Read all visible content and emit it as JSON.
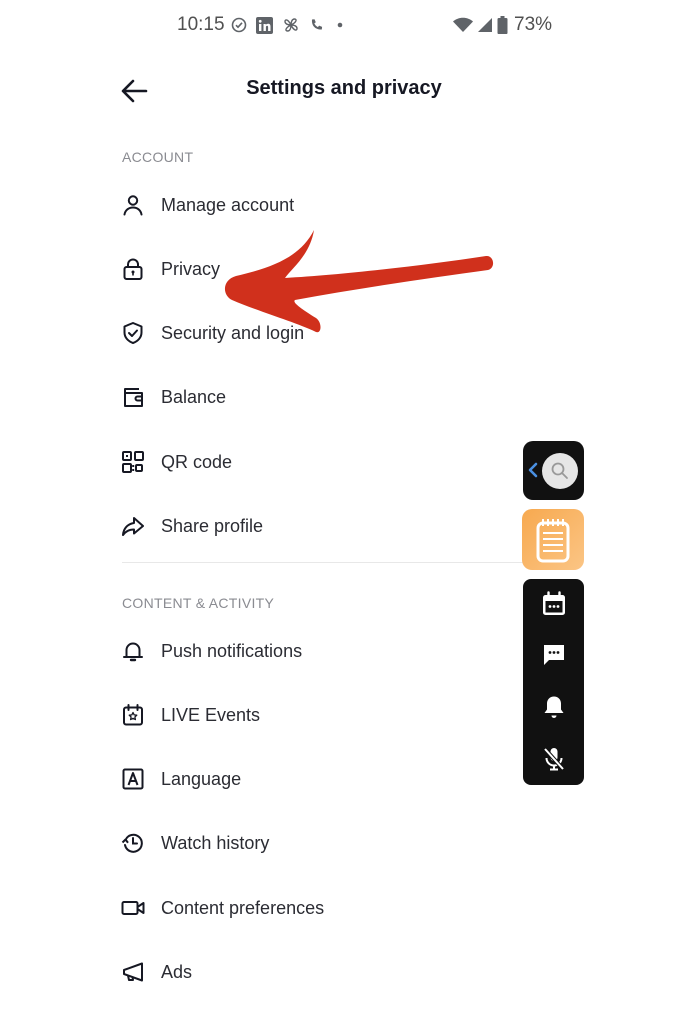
{
  "status_bar": {
    "time": "10:15",
    "left_icons": [
      "check-circle-icon",
      "linkedin-icon",
      "pinwheel-icon",
      "phone-icon",
      "dot-icon"
    ],
    "right_icons": [
      "wifi-icon",
      "signal-icon",
      "battery-icon"
    ],
    "battery": "73%"
  },
  "header": {
    "back_icon": "arrow-left-icon",
    "title": "Settings and privacy"
  },
  "sections": [
    {
      "label": "ACCOUNT",
      "items": [
        {
          "label": "Manage account",
          "icon": "person-icon"
        },
        {
          "label": "Privacy",
          "icon": "lock-icon"
        },
        {
          "label": "Security and login",
          "icon": "shield-check-icon"
        },
        {
          "label": "Balance",
          "icon": "wallet-icon"
        },
        {
          "label": "QR code",
          "icon": "qr-code-icon"
        },
        {
          "label": "Share profile",
          "icon": "share-arrow-icon"
        }
      ]
    },
    {
      "label": "CONTENT & ACTIVITY",
      "items": [
        {
          "label": "Push notifications",
          "icon": "bell-icon"
        },
        {
          "label": "LIVE Events",
          "icon": "calendar-star-icon"
        },
        {
          "label": "Language",
          "icon": "letter-a-icon"
        },
        {
          "label": "Watch history",
          "icon": "history-icon"
        },
        {
          "label": "Content preferences",
          "icon": "video-camera-icon"
        },
        {
          "label": "Ads",
          "icon": "megaphone-icon"
        }
      ]
    }
  ],
  "annotation": {
    "type": "red-arrow",
    "points_to": "Privacy",
    "color": "#d0301c"
  },
  "floating_toolbar": {
    "search_icon": "search-icon",
    "collapse_icon": "chevron-left-icon",
    "note_icon": "notepad-icon",
    "note_color": "#f7a94f",
    "items": [
      "calendar-icon",
      "chat-bubble-icon",
      "bell-icon",
      "mic-off-icon"
    ]
  }
}
